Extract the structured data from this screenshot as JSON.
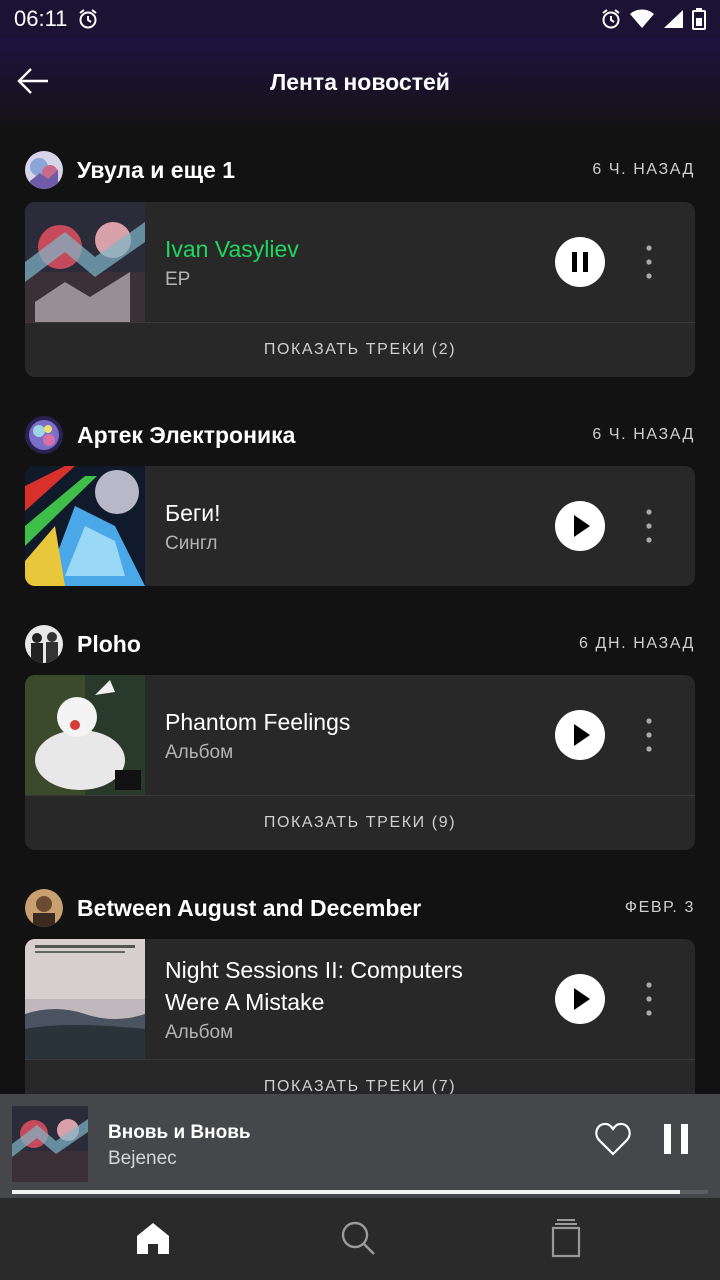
{
  "status_bar": {
    "time": "06:11"
  },
  "header": {
    "title": "Лента новостей"
  },
  "colors": {
    "accent_green": "#1ed760",
    "card_bg": "#282828",
    "background": "#121212",
    "mini_player_bg": "#46474b"
  },
  "feed": [
    {
      "group_name": "Увула и еще 1",
      "time": "6 Ч. НАЗАД",
      "release_title": "Ivan Vasyliev",
      "release_type": "EP",
      "playing": true,
      "show_tracks": "ПОКАЗАТЬ ТРЕКИ (2)"
    },
    {
      "group_name": "Артек Электроника",
      "time": "6 Ч. НАЗАД",
      "release_title": "Беги!",
      "release_type": "Сингл",
      "playing": false
    },
    {
      "group_name": "Ploho",
      "time": "6 ДН. НАЗАД",
      "release_title": "Phantom Feelings",
      "release_type": "Альбом",
      "playing": false,
      "show_tracks": "ПОКАЗАТЬ ТРЕКИ (9)"
    },
    {
      "group_name": "Between August and December",
      "time": "ФЕВР. 3",
      "release_title_line1": "Night Sessions II: Computers",
      "release_title_line2": "Were A Mistake",
      "release_type": "Альбом",
      "playing": false,
      "show_tracks": "ПОКАЗАТЬ ТРЕКИ (7)"
    }
  ],
  "mini_player": {
    "track_title": "Вновь и Вновь",
    "artist": "Bejenec",
    "progress": 0.96,
    "liked": false,
    "playing": true
  },
  "bottom_nav": {
    "items": [
      {
        "icon": "home-icon",
        "active": true
      },
      {
        "icon": "search-icon",
        "active": false
      },
      {
        "icon": "library-icon",
        "active": false
      }
    ]
  }
}
